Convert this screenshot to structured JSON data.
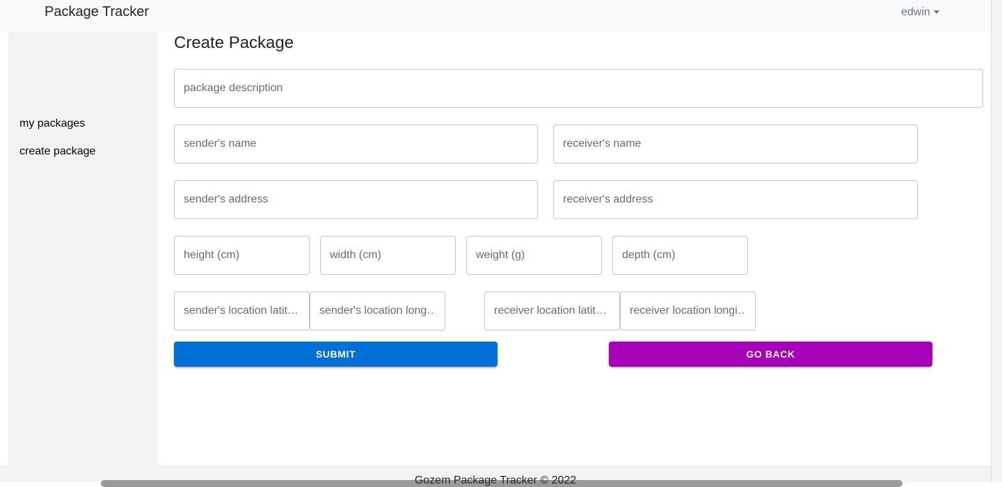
{
  "navbar": {
    "brand": "Package Tracker",
    "user": "edwin"
  },
  "sidebar": {
    "items": [
      {
        "label": "my packages"
      },
      {
        "label": "create package"
      }
    ]
  },
  "main": {
    "title": "Create Package",
    "fields": {
      "package_description": "package description",
      "sender_name": "sender's name",
      "receiver_name": "receiver's name",
      "sender_address": "sender's address",
      "receiver_address": "receiver's address",
      "height": "height (cm)",
      "width": "width (cm)",
      "weight": "weight (g)",
      "depth": "depth (cm)",
      "sender_lat": "sender's location latit…",
      "sender_long": "sender's location long…",
      "receiver_lat": "receiver location latit…",
      "receiver_long": "receiver location longi…"
    },
    "buttons": {
      "submit": "SUBMIT",
      "back": "GO BACK"
    }
  },
  "footer": {
    "text": "Gozem Package Tracker © 2022"
  },
  "colors": {
    "submit": "#006fd6",
    "back": "#a600b9",
    "sidebar_bg": "#f3f3f3",
    "navbar_bg": "#f8f9fa"
  }
}
